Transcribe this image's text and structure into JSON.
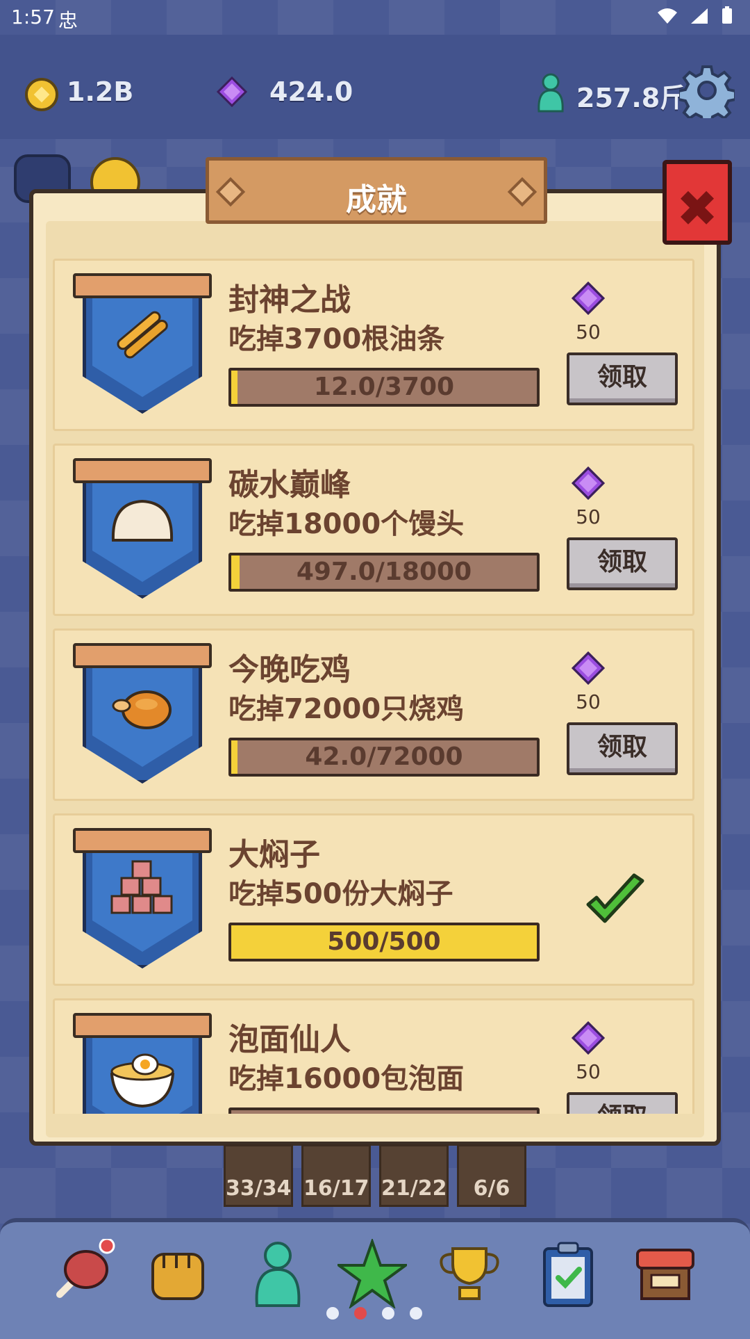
{
  "status_bar": {
    "time": "1:57",
    "bug_glyph": "忠"
  },
  "resources": {
    "coins": "1.2B",
    "gems": "424.0",
    "weight": "257.8斤"
  },
  "dialog": {
    "title": "成就",
    "achievements": [
      {
        "name": "封神之战",
        "desc": "吃掉3700根油条",
        "progress_text": "12.0/3700",
        "progress": 0.003,
        "reward": "50",
        "claim_label": "领取",
        "completed": false,
        "icon": "youtiao-icon"
      },
      {
        "name": "碳水巅峰",
        "desc": "吃掉18000个馒头",
        "progress_text": "497.0/18000",
        "progress": 0.028,
        "reward": "50",
        "claim_label": "领取",
        "completed": false,
        "icon": "mantou-icon"
      },
      {
        "name": "今晚吃鸡",
        "desc": "吃掉72000只烧鸡",
        "progress_text": "42.0/72000",
        "progress": 0.001,
        "reward": "50",
        "claim_label": "领取",
        "completed": false,
        "icon": "roast-chicken-icon"
      },
      {
        "name": "大焖子",
        "desc": "吃掉500份大焖子",
        "progress_text": "500/500",
        "progress": 1.0,
        "reward": "",
        "claim_label": "",
        "completed": true,
        "icon": "menzi-cubes-icon"
      },
      {
        "name": "泡面仙人",
        "desc": "吃掉16000包泡面",
        "progress_text": "",
        "progress": 0,
        "reward": "50",
        "claim_label": "领取",
        "completed": false,
        "icon": "instant-noodle-icon"
      }
    ]
  },
  "food_dock": [
    "33/34",
    "16/17",
    "21/22",
    "6/6"
  ],
  "colors": {
    "accent_red": "#e23737",
    "progress_fill": "#f4d13a",
    "panel_bg": "#f7e8c4",
    "banner_blue": "#2f5ea8"
  }
}
